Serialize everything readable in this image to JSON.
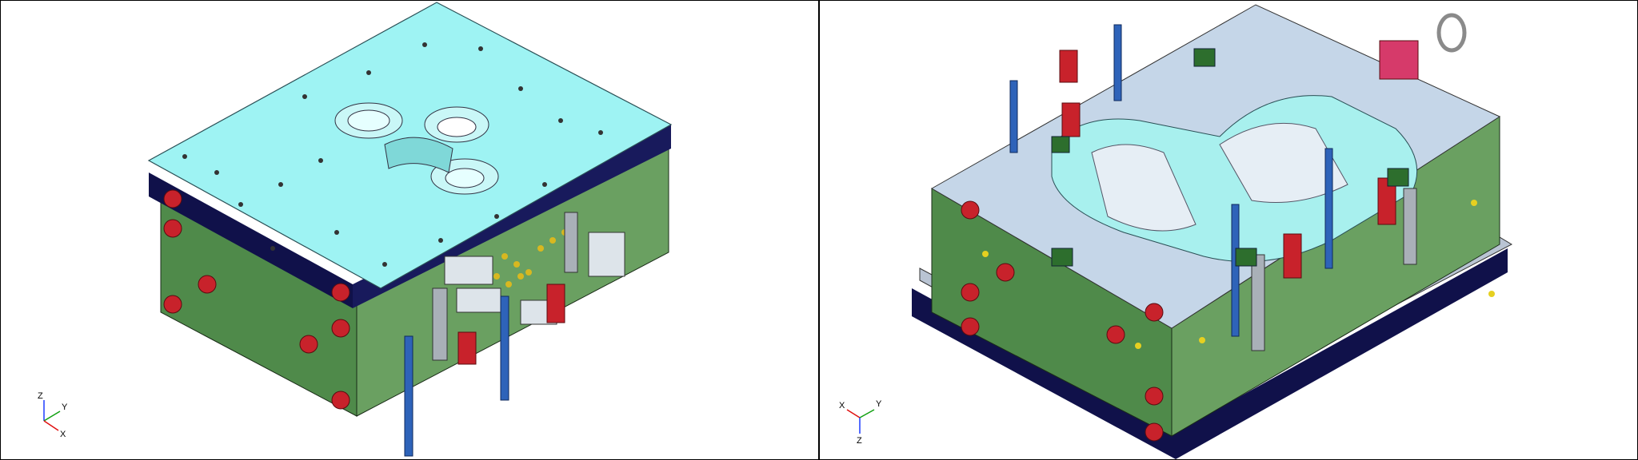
{
  "viewports": [
    {
      "name": "left",
      "triad": {
        "z": "Z",
        "y": "Y",
        "x": "X"
      }
    },
    {
      "name": "right",
      "triad": {
        "x": "X",
        "y": "Y",
        "z": "Z"
      }
    }
  ],
  "colors": {
    "plate_top": "#9ef3f3",
    "mold_side": "#4f8a4a",
    "navy_band": "#10114a",
    "steel": "#b9c4d3",
    "cavity_cyan": "#a8f0ee",
    "red_part": "#c8222b",
    "blue_rod": "#2e63b9",
    "pink_block": "#d63a6a"
  },
  "icons": [
    "triad-axis-icon",
    "triad-axis-icon"
  ]
}
